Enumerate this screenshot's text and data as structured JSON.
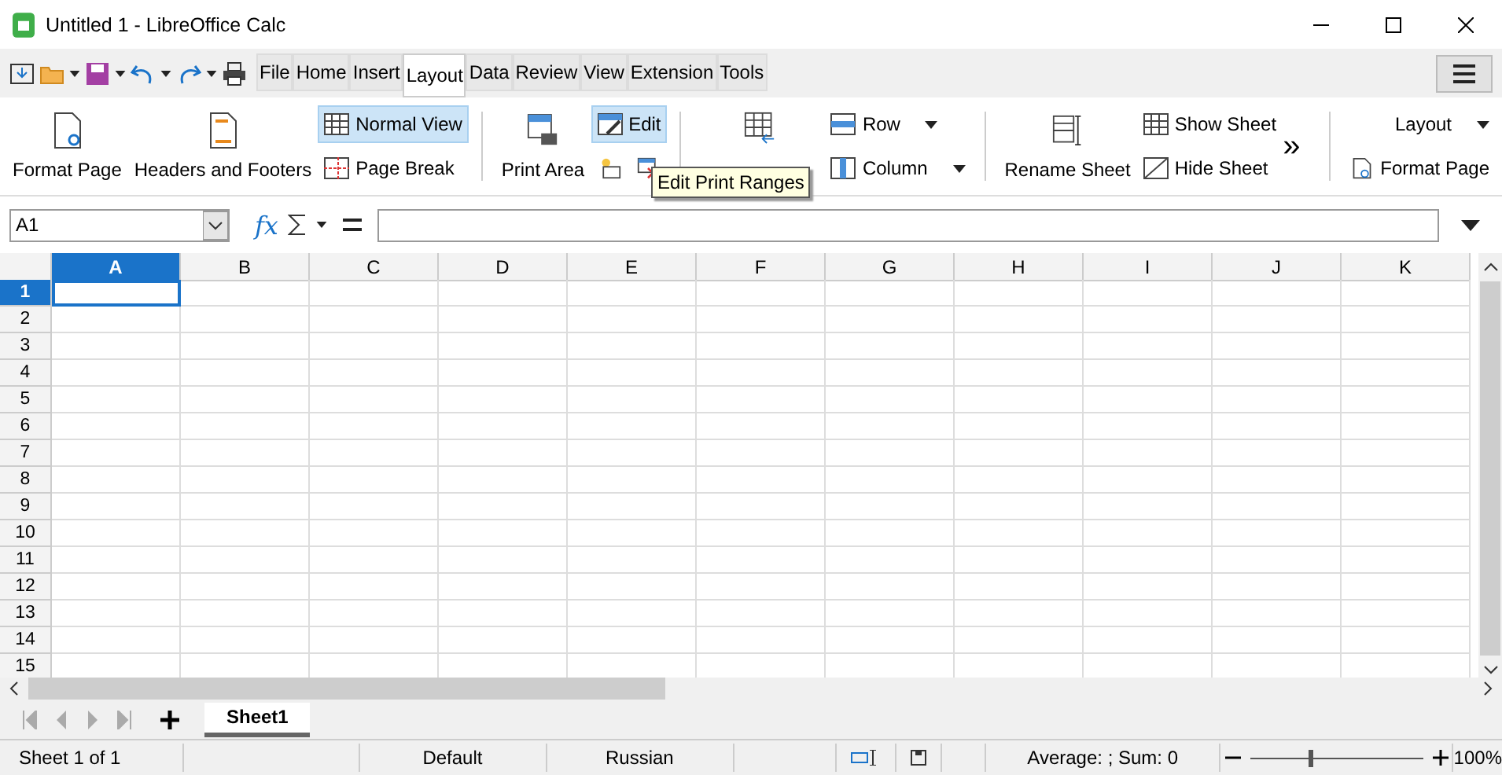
{
  "window": {
    "title": "Untitled 1 - LibreOffice Calc"
  },
  "menu_tabs": [
    {
      "label": "File",
      "selected": false
    },
    {
      "label": "Home",
      "selected": false
    },
    {
      "label": "Insert",
      "selected": false
    },
    {
      "label": "Layout",
      "selected": true
    },
    {
      "label": "Data",
      "selected": false
    },
    {
      "label": "Review",
      "selected": false
    },
    {
      "label": "View",
      "selected": false
    },
    {
      "label": "Extension",
      "selected": false
    },
    {
      "label": "Tools",
      "selected": false
    }
  ],
  "ribbon": {
    "format_page": "Format Page",
    "headers_footers": "Headers and Footers",
    "normal_view": {
      "label": "Normal View",
      "selected": true
    },
    "page_break": {
      "label": "Page Break",
      "selected": false
    },
    "print_area": "Print Area",
    "edit": {
      "label": "Edit",
      "selected": true
    },
    "row": "Row",
    "column": "Column",
    "rename_sheet": "Rename Sheet",
    "show_sheet": "Show Sheet",
    "hide_sheet": "Hide Sheet",
    "more": "»",
    "layout_dropdown": "Layout",
    "format_page_right": "Format Page"
  },
  "tooltip": "Edit Print Ranges",
  "formula_bar": {
    "name_box": "A1",
    "function_icon": "fx"
  },
  "grid": {
    "columns": [
      {
        "label": "A",
        "selected": true
      },
      {
        "label": "B",
        "selected": false
      },
      {
        "label": "C",
        "selected": false
      },
      {
        "label": "D",
        "selected": false
      },
      {
        "label": "E",
        "selected": false
      },
      {
        "label": "F",
        "selected": false
      },
      {
        "label": "G",
        "selected": false
      },
      {
        "label": "H",
        "selected": false
      },
      {
        "label": "I",
        "selected": false
      },
      {
        "label": "J",
        "selected": false
      },
      {
        "label": "K",
        "selected": false
      }
    ],
    "rows": [
      {
        "label": "1",
        "selected": true
      },
      {
        "label": "2",
        "selected": false
      },
      {
        "label": "3",
        "selected": false
      },
      {
        "label": "4",
        "selected": false
      },
      {
        "label": "5",
        "selected": false
      },
      {
        "label": "6",
        "selected": false
      },
      {
        "label": "7",
        "selected": false
      },
      {
        "label": "8",
        "selected": false
      },
      {
        "label": "9",
        "selected": false
      },
      {
        "label": "10",
        "selected": false
      },
      {
        "label": "11",
        "selected": false
      },
      {
        "label": "12",
        "selected": false
      },
      {
        "label": "13",
        "selected": false
      },
      {
        "label": "14",
        "selected": false
      },
      {
        "label": "15",
        "selected": false
      }
    ]
  },
  "sheet_tabs": [
    {
      "label": "Sheet1",
      "selected": true
    }
  ],
  "status_bar": {
    "sheet": "Sheet 1 of 1",
    "page_style": "Default",
    "language": "Russian",
    "summary": "Average: ; Sum: 0",
    "zoom": {
      "level": 0.35
    },
    "zoom_percent": "100%"
  }
}
